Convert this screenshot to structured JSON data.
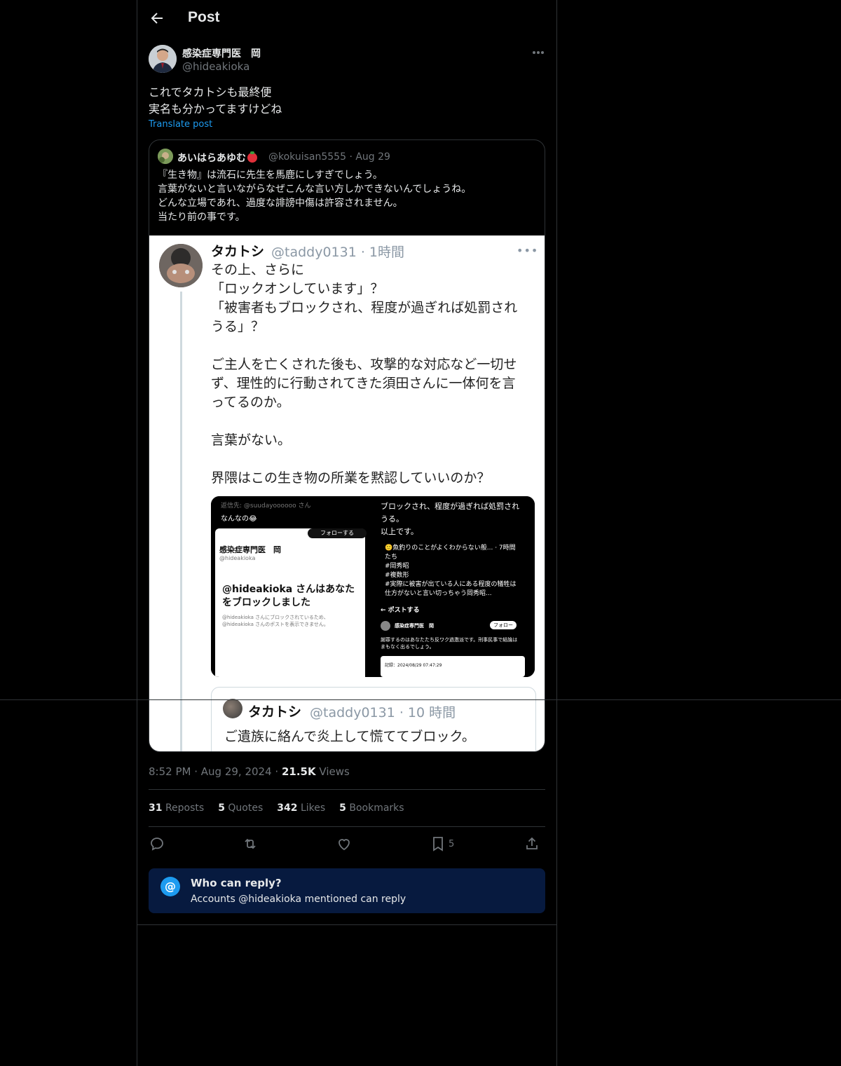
{
  "header": {
    "title": "Post"
  },
  "author": {
    "display_name": "感染症専門医　岡",
    "handle": "@hideakioka"
  },
  "post": {
    "text": "これでタカトシも最終便\n実名も分かってますけどね",
    "translate_label": "Translate post",
    "time": "8:52 PM",
    "date": "Aug 29, 2024",
    "views_count": "21.5K",
    "views_label": "Views"
  },
  "quote": {
    "display_name": "あいはらあゆむ",
    "handle_meta": "@kokuisan5555 · Aug 29",
    "text": "『生き物』は流石に先生を馬鹿にしすぎでしょう。\n言葉がないと言いながらなぜこんな言い方しかできないんでしょうね。\nどんな立場であれ、過度な誹謗中傷は許容されません。\n当たり前の事です。"
  },
  "screenshot": {
    "name": "タカトシ",
    "meta": "@taddy0131 · 1時間",
    "text": "その上、さらに\n「ロックオンしています」？\n「被害者もブロックされ、程度が過ぎれば処罰され\nうる」？\n\nご主人を亡くされた後も、攻撃的な対応など一切せ\nず、理性的に行動されてきた須田さんに一体何を言\nってるのか。\n\n言葉がない。\n\n界隈はこの生き物の所業を黙認していいのか？",
    "img1": {
      "reply_to": "返信先: @suudayoooooo さん",
      "line2": "なんなの😂",
      "follow": "フォローする",
      "name": "感染症専門医　岡",
      "handle": "@hideakioka",
      "blocked": "@hideakioka さんはあなた\nをブロックしました",
      "small": "@hideakioka さんにブロックされているため、\n@hideakioka さんのポストを表示できません。"
    },
    "img2": {
      "top": "ブロックされ、程度が過ぎれば処罰され\nうる。\n以上です。",
      "quoted": "🙂魚釣りのことがよくわからない般... · 7時間\nたち\n#岡秀昭\n#複数形\n#実際に被害が出ている人にある程度の犠牲は\n仕方がないと言い切っちゃう岡秀昭...",
      "post_label": "←   ポストする",
      "name": "感染症専門医　岡",
      "follow": "フォロー",
      "body": "謝罪するのはあなたたち反ワク過激派です。刑事民事で結論は\nまもなく出るでしょう。",
      "record": "記録：2024/08/29 07:47:29"
    },
    "inner": {
      "name": "タカトシ",
      "meta": "@taddy0131 · 10 時間",
      "text": "ご遺族に絡んで炎上して慌ててブロック。"
    }
  },
  "stats": {
    "reposts_count": "31",
    "reposts_label": "Reposts",
    "quotes_count": "5",
    "quotes_label": "Quotes",
    "likes_count": "342",
    "likes_label": "Likes",
    "bookmarks_count": "5",
    "bookmarks_label": "Bookmarks"
  },
  "actions": {
    "bookmark_count": "5"
  },
  "who_can_reply": {
    "title": "Who can reply?",
    "subtitle": "Accounts @hideakioka mentioned can reply"
  },
  "colors": {
    "accent": "#1d9bf0",
    "background": "#000000",
    "muted": "#71767b",
    "reply_box": "#071a3f"
  }
}
